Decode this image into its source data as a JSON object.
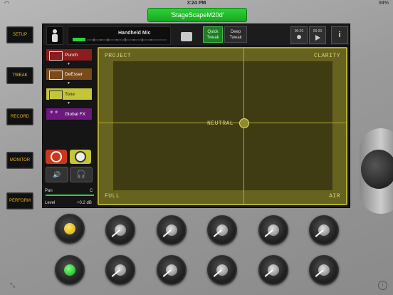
{
  "status_bar": {
    "time": "3:24 PM",
    "battery": "94%",
    "wifi": "◠"
  },
  "app_title": "'StageScapeM20d'",
  "side_nav": [
    {
      "label": "SETUP"
    },
    {
      "label": "TWEAK"
    },
    {
      "label": "RECORD"
    },
    {
      "label": "MONITOR"
    },
    {
      "label": "PERFORM"
    }
  ],
  "channel": {
    "name": "Handheld Mic"
  },
  "top_buttons": {
    "quick_tweak": "Quick Tweak",
    "deep_tweak": "Deep Tweak",
    "rec_time": "00:20",
    "play_time": "00:20",
    "info": "i"
  },
  "fx_chain": [
    {
      "label": "Punch",
      "color": "#8a1e1e"
    },
    {
      "label": "DeEsser",
      "color": "#7a4a1a"
    },
    {
      "label": "Tone",
      "color": "#c5c53a"
    },
    {
      "label": "Global FX",
      "color": "#6a1a7a"
    }
  ],
  "controls": {
    "pan_label": "Pan",
    "pan_value": "C",
    "level_label": "Level",
    "level_value": "+0.2 dB"
  },
  "xy_pad": {
    "top_left": "PROJECT",
    "top_right": "CLARITY",
    "center": "NEUTRAL",
    "bottom_left": "FULL",
    "bottom_right": "AIR"
  },
  "colors": {
    "accent_green": "#2fd03a",
    "pad_yellow": "#b6ad2f",
    "nav_text": "#e7b21d"
  }
}
